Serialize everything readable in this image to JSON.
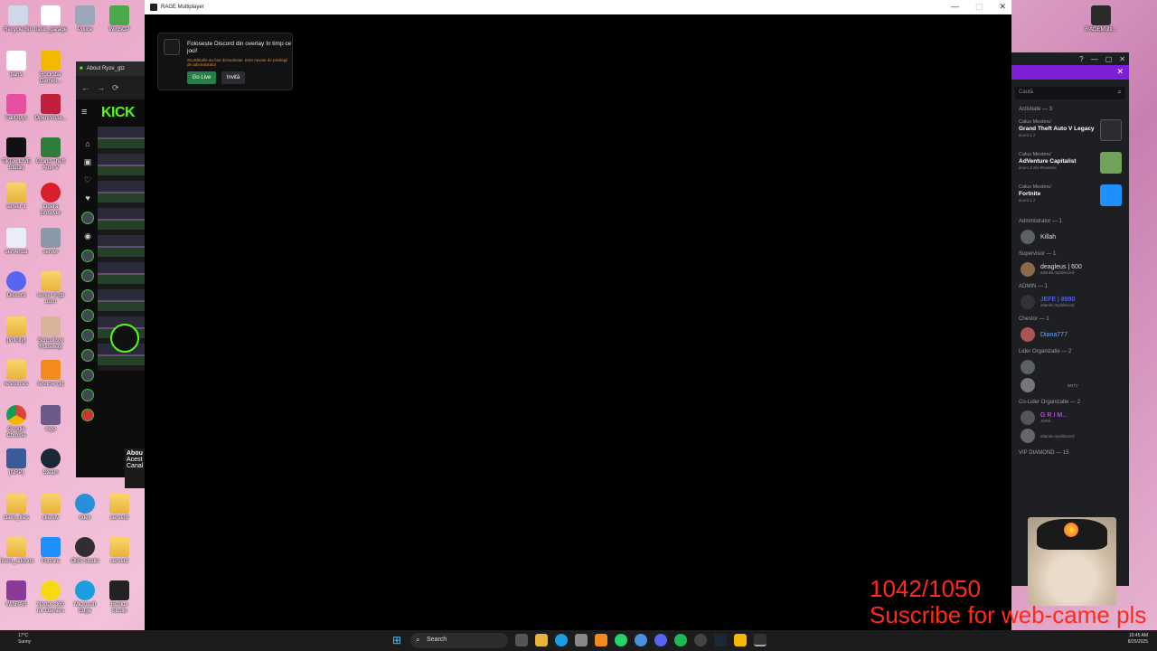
{
  "desktop_icons": [
    {
      "label": "Recycle Bin"
    },
    {
      "label": "basic_garage"
    },
    {
      "label": "Police"
    },
    {
      "label": "WinSCP"
    },
    {
      "label": "bans"
    },
    {
      "label": "Rockstar Games..."
    },
    {
      "label": "FallGuys"
    },
    {
      "label": "OpenIV/Ga..."
    },
    {
      "label": "TikTok LIVE Studio"
    },
    {
      "label": "Grand Theft Auto V"
    },
    {
      "label": "server 1"
    },
    {
      "label": "Opera Browser"
    },
    {
      "label": "serverlua"
    },
    {
      "label": "server"
    },
    {
      "label": "Discord"
    },
    {
      "label": "server 8 gb burn"
    },
    {
      "label": "[Infinity]"
    },
    {
      "label": "Schoolboy Runaway"
    },
    {
      "label": "resources"
    },
    {
      "label": "resurse (1)"
    },
    {
      "label": "Google Chrome"
    },
    {
      "label": "logo"
    },
    {
      "label": "[NRP]"
    },
    {
      "label": "Steam"
    },
    {
      "label": "client_files"
    },
    {
      "label": "clientiv"
    },
    {
      "label": "ridex"
    },
    {
      "label": "server8"
    },
    {
      "label": "fivem_addons"
    },
    {
      "label": "Fortnite"
    },
    {
      "label": "OBS Studio"
    },
    {
      "label": "server2"
    },
    {
      "label": "WinRAR"
    },
    {
      "label": "Norton 360 for Gamers"
    },
    {
      "label": "Microsoft Edge"
    },
    {
      "label": "Roblox Studio"
    },
    {
      "label": "RAGEMulti..."
    }
  ],
  "browser": {
    "tab_title": "About Ryze_gtz",
    "logo": "KICK",
    "about_heading": "Abou",
    "about_lines": [
      "Acest",
      "Canal"
    ]
  },
  "game_window": {
    "title": "RAGE Multiplayer",
    "controls": {
      "minimize": "—",
      "maximize": "▢",
      "close": "✕"
    }
  },
  "discord_toast": {
    "title": "Folosește Discord din overlay în timp ce joci!",
    "warning": "Scurtăturile au fost dezactivate. Este nevoie de privilegii de administrator",
    "go_live_label": "Go Live",
    "invite_label": "Invită"
  },
  "discord_panel": {
    "search_placeholder": "Caută",
    "activity_header": "Activitate — 3",
    "activities": [
      {
        "who": "Calus Mesteru'",
        "game": "Grand Theft Auto V Legacy",
        "time": "acum 1 z",
        "color": "#2b2d31"
      },
      {
        "who": "Calus Mesteru'",
        "game": "AdVenture Capitalist",
        "time": "acum 3 zile  Revenire",
        "color": "#6fa35a"
      },
      {
        "who": "Calus Mesteru'",
        "game": "Fortnite",
        "time": "acum 1 z",
        "color": "#1e90ff"
      }
    ],
    "groups": [
      {
        "header": "Administrator — 1",
        "members": [
          {
            "name": "Killah",
            "sub": "",
            "color": "#dbdee1"
          }
        ]
      },
      {
        "header": "Supervisor — 1",
        "members": [
          {
            "name": "deagleus | 600",
            "sub": "atlantis.mp/discord",
            "color": "#dbdee1"
          }
        ]
      },
      {
        "header": "ADMIN — 1",
        "members": [
          {
            "name": "JEFE | 8990",
            "sub": "atlantis.mp/discord",
            "color": "#6c7bff"
          }
        ]
      },
      {
        "header": "Chestor — 1",
        "members": [
          {
            "name": "Diana777",
            "sub": "",
            "color": "#6aa8ff"
          }
        ]
      },
      {
        "header": "Lider Organizatie — 2",
        "members": [
          {
            "name": "",
            "sub": "",
            "color": "#dbdee1"
          },
          {
            "name": "",
            "sub": "BRTV",
            "color": "#dbdee1"
          }
        ]
      },
      {
        "header": "Co-Lider Organizatie — 2",
        "members": [
          {
            "name": "G R I M...",
            "sub": "JKRS",
            "color": "#d46bff"
          },
          {
            "name": "",
            "sub": "atlantis.mp/discord",
            "color": "#dbdee1"
          }
        ]
      },
      {
        "header": "VIP DIAMOND — 15",
        "members": []
      }
    ]
  },
  "stream_overlay": {
    "counter": "1042/1050",
    "subscribe_text": "Suscribe for web-came pls"
  },
  "taskbar": {
    "weather_temp": "17°C",
    "weather_desc": "Sunny",
    "search_label": "Search",
    "time": "10:45 AM",
    "date": "8/25/2025"
  }
}
